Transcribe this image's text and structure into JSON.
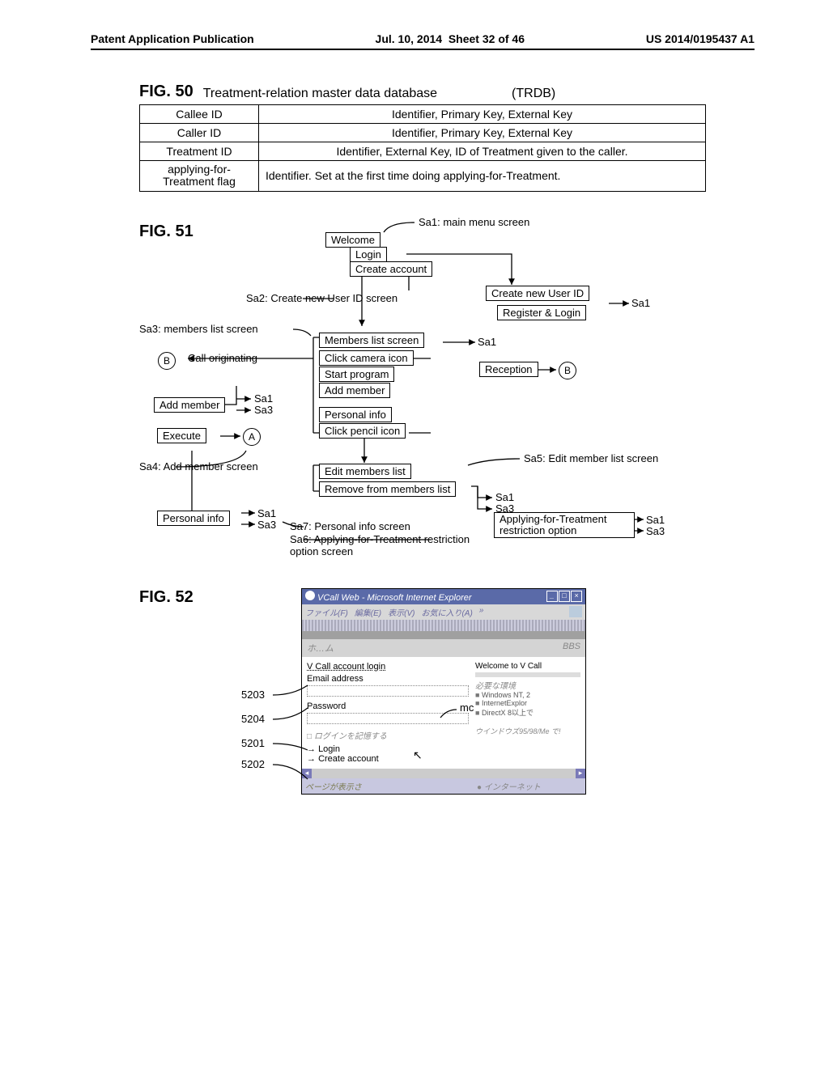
{
  "header": {
    "pub": "Patent Application Publication",
    "date": "Jul. 10, 2014",
    "sheet": "Sheet 32 of 46",
    "docnum": "US 2014/0195437 A1"
  },
  "fig50": {
    "title": "FIG. 50",
    "caption": "Treatment-relation master data database",
    "code": "(TRDB)",
    "rows": [
      {
        "field": "Callee ID",
        "desc": "Identifier, Primary Key, External Key"
      },
      {
        "field": "Caller ID",
        "desc": "Identifier, Primary Key, External Key"
      },
      {
        "field": "Treatment ID",
        "desc": "Identifier, External Key, ID of Treatment given to the caller."
      },
      {
        "field": "applying-for-Treatment flag",
        "desc": "Identifier. Set at the first time doing applying-for-Treatment."
      }
    ]
  },
  "fig51": {
    "title": "FIG. 51",
    "sa1": "Sa1: main menu screen",
    "welcome": "Welcome",
    "login": "Login",
    "create_account": "Create account",
    "create_new_userid": "Create new User ID",
    "sa2": "Sa2: Create new User ID screen",
    "register_login": "Register & Login",
    "goto_sa1": "Sa1",
    "sa3": "Sa3: members list screen",
    "members_list_screen": "Members list screen",
    "call_originating": "Call originating",
    "click_camera_icon": "Click camera icon",
    "reception": "Reception",
    "start_program": "Start program",
    "add_member": "Add member",
    "personal_info": "Personal info",
    "click_pencil_icon": "Click pencil icon",
    "execute": "Execute",
    "goto_sa3": "Sa3",
    "sa4": "Sa4: Add member screen",
    "edit_members_list": "Edit members list",
    "remove_from_ml": "Remove from members list",
    "sa5": "Sa5: Edit member list screen",
    "sa6": "Sa6: Applying-for-Treatment restriction option screen",
    "sa7": "Sa7: Personal info screen",
    "applying_restriction": "Applying-for-Treatment restriction option",
    "circle_a": "A",
    "circle_b": "B"
  },
  "fig52": {
    "title": "FIG. 52",
    "window_title": "VCall Web - Microsoft Internet Explorer",
    "menu": {
      "file": "ファイル(F)",
      "edit": "編集(E)",
      "view": "表示(V)",
      "fav": "お気に入り(A)",
      "more": "»"
    },
    "namebar_left": "ホ…ム",
    "namebar_right": "BBS",
    "login_heading": "V Call account login",
    "welcome_heading": "Welcome to V Call",
    "email_label": "Email address",
    "req_env": "必要な環境",
    "password_label": "Password",
    "bullets": [
      "Windows NT, 2",
      "InternetExplor",
      "DirectX 8以上で"
    ],
    "remember": "ログインを記憶する",
    "login_btn": "Login",
    "create_acc": "Create account",
    "win_note": "ウインドウズ95/98/Me  で!",
    "status_left": "ページが表示さ",
    "status_right": "インターネット",
    "callouts": {
      "5203": "5203",
      "5204": "5204",
      "5201": "5201",
      "5202": "5202"
    },
    "mc": "mc"
  }
}
